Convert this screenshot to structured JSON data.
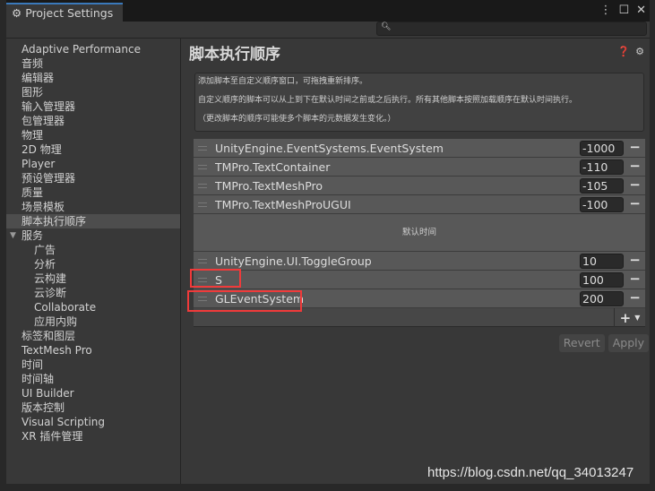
{
  "window": {
    "title": "Project Settings",
    "menu_icon": "kebab-icon",
    "maximize_icon": "maximize-icon",
    "close_icon": "close-icon"
  },
  "search": {
    "value": "",
    "icon": "search-icon"
  },
  "sidebar": {
    "items": [
      {
        "label": "Adaptive Performance"
      },
      {
        "label": "音频"
      },
      {
        "label": "编辑器"
      },
      {
        "label": "图形"
      },
      {
        "label": "输入管理器"
      },
      {
        "label": "包管理器"
      },
      {
        "label": "物理"
      },
      {
        "label": "2D 物理"
      },
      {
        "label": "Player"
      },
      {
        "label": "预设管理器"
      },
      {
        "label": "质量"
      },
      {
        "label": "场景模板"
      },
      {
        "label": "脚本执行顺序",
        "selected": true
      },
      {
        "label": "服务",
        "expanded": true
      },
      {
        "label": "广告",
        "sub": true
      },
      {
        "label": "分析",
        "sub": true
      },
      {
        "label": "云构建",
        "sub": true
      },
      {
        "label": "云诊断",
        "sub": true
      },
      {
        "label": "Collaborate",
        "sub": true
      },
      {
        "label": "应用内购",
        "sub": true
      },
      {
        "label": "标签和图层"
      },
      {
        "label": "TextMesh Pro"
      },
      {
        "label": "时间"
      },
      {
        "label": "时间轴"
      },
      {
        "label": "UI Builder"
      },
      {
        "label": "版本控制"
      },
      {
        "label": "Visual Scripting"
      },
      {
        "label": "XR 插件管理"
      }
    ]
  },
  "main": {
    "title": "脚本执行顺序",
    "description": [
      "添加脚本至自定义顺序窗口，可拖拽重新排序。",
      "自定义顺序的脚本可以从上到下在默认时间之前或之后执行。所有其他脚本按照加载顺序在默认时间执行。",
      "（更改脚本的顺序可能使多个脚本的元数据发生变化。）"
    ],
    "before": [
      {
        "name": "UnityEngine.EventSystems.EventSystem",
        "order": "-1000"
      },
      {
        "name": "TMPro.TextContainer",
        "order": "-110"
      },
      {
        "name": "TMPro.TextMeshPro",
        "order": "-105"
      },
      {
        "name": "TMPro.TextMeshProUGUI",
        "order": "-100"
      }
    ],
    "default_label": "默认时间",
    "after": [
      {
        "name": "UnityEngine.UI.ToggleGroup",
        "order": "10"
      },
      {
        "name": "S",
        "order": "100"
      },
      {
        "name": "GLEventSystem",
        "order": "200"
      }
    ],
    "revert_label": "Revert",
    "apply_label": "Apply"
  },
  "highlight_color": "#f03a3a",
  "watermark": "https://blog.csdn.net/qq_34013247"
}
